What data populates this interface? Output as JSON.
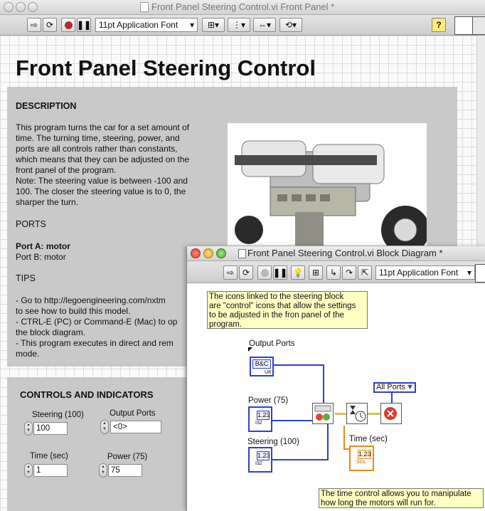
{
  "front_panel": {
    "window_title": "Front Panel Steering Control.vi Front Panel *",
    "font_select": "11pt Application Font",
    "heading": "Front Panel Steering Control",
    "description": {
      "heading": "DESCRIPTION",
      "text_lines": [
        "This program turns the car for a set amount of",
        "time. The turning time, steering, power, and",
        "ports are all controls rather than constants,",
        "which means that they can be adjusted on the",
        "front panel of the program.",
        "Note:  The steering value is between -100 and",
        "100.  The closer the steering value is to 0, the",
        "sharper the turn."
      ]
    },
    "ports": {
      "heading": "PORTS",
      "port_a": "Port A: motor",
      "port_b": "Port B: motor"
    },
    "tips": {
      "heading": "TIPS",
      "lines": [
        "- Go to http://legoengineering.com/nxtm",
        "to see how to build this model.",
        "- CTRL-E (PC) or Command-E (Mac) to op",
        "the block diagram.",
        "- This program executes in direct and rem",
        "mode."
      ]
    },
    "controls": {
      "heading": "CONTROLS AND INDICATORS",
      "steering": {
        "label": "Steering (100)",
        "value": "100"
      },
      "output_ports": {
        "label": "Output Ports",
        "value": "<0>"
      },
      "time": {
        "label": "Time (sec)",
        "value": "1"
      },
      "power": {
        "label": "Power (75)",
        "value": "75"
      }
    }
  },
  "block_diagram": {
    "window_title": "Front Panel Steering Control.vi Block Diagram *",
    "font_select": "11pt Application Font",
    "note_top": [
      "The icons linked to the steering block",
      "are \"control\" icons that allow the settings",
      "to be adjusted in the fron panel of the",
      "program."
    ],
    "note_bottom": [
      "The time control allows you to manipulate",
      "how long the motors will run for."
    ],
    "terminals": {
      "output_ports": {
        "label": "Output Ports",
        "value": "B&C",
        "type": "U8"
      },
      "power": {
        "label": "Power (75)",
        "value": "1.23",
        "type": "I32"
      },
      "steering": {
        "label": "Steering (100)",
        "value": "1.23",
        "type": "I32"
      },
      "time": {
        "label": "Time (sec)",
        "value": "1.23",
        "type": "SGL"
      }
    },
    "all_ports_select": "All Ports"
  },
  "colors": {
    "wire_numeric": "#2f3fd0",
    "wire_float": "#e8891a",
    "note_bg": "#ffffc4",
    "decoration": "#c9c9c9"
  }
}
